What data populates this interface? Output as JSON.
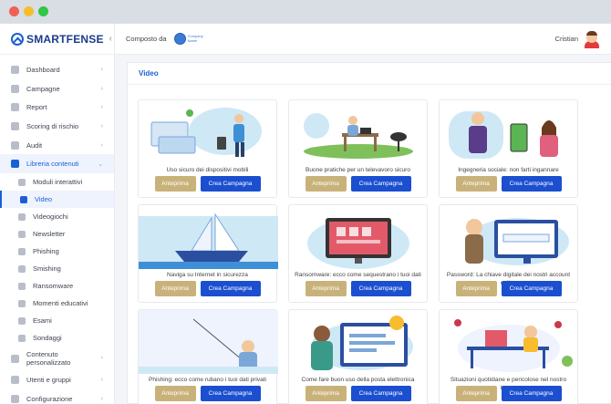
{
  "sidebar": {
    "brand": "SMARTFENSE",
    "items": [
      {
        "label": "Dashboard",
        "icon": "dashboard-icon",
        "chevron": "›"
      },
      {
        "label": "Campagne",
        "icon": "calendar-icon",
        "chevron": "›"
      },
      {
        "label": "Report",
        "icon": "chart-icon",
        "chevron": "›"
      },
      {
        "label": "Scoring di rischio",
        "icon": "shield-icon",
        "chevron": "›"
      },
      {
        "label": "Audit",
        "icon": "clipboard-icon",
        "chevron": "›"
      },
      {
        "label": "Libreria contenuti",
        "icon": "library-icon",
        "chevron": "⌄"
      }
    ],
    "subitems": [
      {
        "label": "Moduli interattivi",
        "icon": "module-icon"
      },
      {
        "label": "Video",
        "icon": "video-icon"
      },
      {
        "label": "Videogiochi",
        "icon": "gamepad-icon"
      },
      {
        "label": "Newsletter",
        "icon": "newsletter-icon"
      },
      {
        "label": "Phishing",
        "icon": "phishing-icon"
      },
      {
        "label": "Smishing",
        "icon": "sms-icon"
      },
      {
        "label": "Ransomware",
        "icon": "ransomware-icon"
      },
      {
        "label": "Momenti educativi",
        "icon": "education-icon"
      },
      {
        "label": "Esami",
        "icon": "exam-icon"
      },
      {
        "label": "Sondaggi",
        "icon": "survey-icon"
      }
    ],
    "bottom_items": [
      {
        "label": "Contenuto personalizzato",
        "icon": "edit-icon",
        "chevron": "›"
      },
      {
        "label": "Utenti e gruppi",
        "icon": "users-icon",
        "chevron": "›"
      },
      {
        "label": "Configurazione",
        "icon": "gear-icon",
        "chevron": "›"
      }
    ]
  },
  "header": {
    "composed_by": "Composto da",
    "partner_name": "Company Name",
    "user_name": "Cristian"
  },
  "main": {
    "title": "Video",
    "preview_label": "Anteprima",
    "create_label": "Crea Campagna",
    "cards": [
      {
        "title": "Uso sicuro dei dispositivi mobili"
      },
      {
        "title": "Buone pratiche per un televavoro sicuro"
      },
      {
        "title": "Ingegneria sociale: non farti ingannare"
      },
      {
        "title": "Naviga su Internet in sicurezza"
      },
      {
        "title": "Ransomware: ecco come sequestrano i tuoi dati"
      },
      {
        "title": "Password: La chiave digitale dei nostri account online"
      },
      {
        "title": "Phishing: ecco come rubano i tuoi dati privati"
      },
      {
        "title": "Come fare buon uso della posta elettronica"
      },
      {
        "title": "Situazioni quotidiane e pericolose nel nostro lavoro"
      }
    ]
  },
  "colors": {
    "accent": "#1b5fd6",
    "create_button": "#1b4fd0",
    "preview_button": "#c9b27a"
  }
}
